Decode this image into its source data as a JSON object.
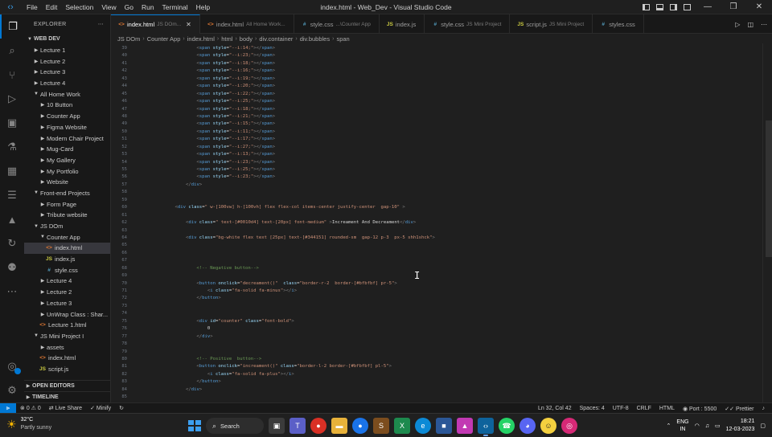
{
  "window": {
    "title": "index.html - Web_Dev - Visual Studio Code",
    "menu": [
      "File",
      "Edit",
      "Selection",
      "View",
      "Go",
      "Run",
      "Terminal",
      "Help"
    ]
  },
  "sidebar": {
    "header": "EXPLORER",
    "items": [
      {
        "label": "WEB DEV",
        "depth": 0,
        "type": "root",
        "open": true
      },
      {
        "label": "Lecture 1",
        "depth": 1,
        "type": "folder",
        "open": false
      },
      {
        "label": "Lecture 2",
        "depth": 1,
        "type": "folder",
        "open": false
      },
      {
        "label": "Lecture 3",
        "depth": 1,
        "type": "folder",
        "open": false
      },
      {
        "label": "Lecture 4",
        "depth": 1,
        "type": "folder",
        "open": false
      },
      {
        "label": "All Home Work",
        "depth": 1,
        "type": "folder",
        "open": true
      },
      {
        "label": "10 Button",
        "depth": 2,
        "type": "folder",
        "open": false
      },
      {
        "label": "Counter App",
        "depth": 2,
        "type": "folder",
        "open": false
      },
      {
        "label": "Figma Website",
        "depth": 2,
        "type": "folder",
        "open": false
      },
      {
        "label": "Modern Chair Project",
        "depth": 2,
        "type": "folder",
        "open": false
      },
      {
        "label": "Mug-Card",
        "depth": 2,
        "type": "folder",
        "open": false
      },
      {
        "label": "My Gallery",
        "depth": 2,
        "type": "folder",
        "open": false
      },
      {
        "label": "My Portfolio",
        "depth": 2,
        "type": "folder",
        "open": false
      },
      {
        "label": "Website",
        "depth": 2,
        "type": "folder",
        "open": false
      },
      {
        "label": "Front-end Projects",
        "depth": 1,
        "type": "folder",
        "open": true
      },
      {
        "label": "Form Page",
        "depth": 2,
        "type": "folder",
        "open": false
      },
      {
        "label": "Tribute website",
        "depth": 2,
        "type": "folder",
        "open": false
      },
      {
        "label": "JS DOm",
        "depth": 1,
        "type": "folder",
        "open": true
      },
      {
        "label": "Counter App",
        "depth": 2,
        "type": "folder",
        "open": true
      },
      {
        "label": "index.html",
        "depth": 3,
        "type": "html",
        "selected": true
      },
      {
        "label": "index.js",
        "depth": 3,
        "type": "js"
      },
      {
        "label": "style.css",
        "depth": 3,
        "type": "css"
      },
      {
        "label": "Lecture 4",
        "depth": 2,
        "type": "folder",
        "open": false
      },
      {
        "label": "Lecture 2",
        "depth": 2,
        "type": "folder",
        "open": false
      },
      {
        "label": "Lecture 3",
        "depth": 2,
        "type": "folder",
        "open": false
      },
      {
        "label": "UnWrap Class : Shar...",
        "depth": 2,
        "type": "folder",
        "open": false
      },
      {
        "label": "Lecture 1.html",
        "depth": 2,
        "type": "html"
      },
      {
        "label": "JS Mini Project I",
        "depth": 1,
        "type": "folder",
        "open": true
      },
      {
        "label": "assets",
        "depth": 2,
        "type": "folder",
        "open": false
      },
      {
        "label": "index.html",
        "depth": 2,
        "type": "html"
      },
      {
        "label": "script.js",
        "depth": 2,
        "type": "js"
      }
    ],
    "sections": [
      "OPEN EDITORS",
      "TIMELINE"
    ]
  },
  "tabs": [
    {
      "icon": "html",
      "label": "index.html",
      "desc": "JS DOm...",
      "active": true
    },
    {
      "icon": "html",
      "label": "index.html",
      "desc": "All Home Work...",
      "active": false
    },
    {
      "icon": "css",
      "label": "style.css",
      "desc": "...\\Counter App",
      "active": false
    },
    {
      "icon": "js",
      "label": "index.js",
      "desc": "",
      "active": false
    },
    {
      "icon": "css",
      "label": "style.css",
      "desc": "JS Mini Project",
      "active": false
    },
    {
      "icon": "js",
      "label": "script.js",
      "desc": "JS Mini Project",
      "active": false
    },
    {
      "icon": "css",
      "label": "styles.css",
      "desc": "",
      "active": false
    }
  ],
  "breadcrumb": [
    "JS DOm",
    "Counter App",
    "index.html",
    "html",
    "body",
    "div.container",
    "div.bubbles",
    "span"
  ],
  "editor": {
    "line_numbers": [
      "39",
      "40",
      "41",
      "42",
      "43",
      "44",
      "45",
      "46",
      "47",
      "48",
      "49",
      "50",
      "51",
      "52",
      "53",
      "54",
      "55",
      "56",
      "57",
      "58",
      "59",
      "60",
      "61",
      "62",
      "63",
      "64",
      "65",
      "66",
      "67",
      "68",
      "69",
      "70",
      "71",
      "72",
      "73",
      "74",
      "75",
      "76",
      "77",
      "78",
      "79",
      "80",
      "81",
      "82",
      "83",
      "84",
      "85"
    ],
    "lines": [
      "            <span style=\"--i:14;\"></span>",
      "            <span style=\"--i:23;\"></span>",
      "            <span style=\"--i:18;\"></span>",
      "            <span style=\"--i:16;\"></span>",
      "            <span style=\"--i:19;\"></span>",
      "            <span style=\"--i:20;\"></span>",
      "            <span style=\"--i:22;\"></span>",
      "            <span style=\"--i:25;\"></span>",
      "            <span style=\"--i:18;\"></span>",
      "            <span style=\"--i:21;\"></span>",
      "            <span style=\"--i:15;\"></span>",
      "            <span style=\"--i:11;\"></span>",
      "            <span style=\"--i:17;\"></span>",
      "            <span style=\"--i:27;\"></span>",
      "            <span style=\"--i:13;\"></span>",
      "            <span style=\"--i:23;\"></span>",
      "            <span style=\"--i:25;\"></span>",
      "            <span style=\"--i:23;\"></span>",
      "        </div>",
      "",
      "",
      "    <div class=\" w-[100vw] h-[100vh] flex flex-col items-center justify-center  gap-10\" >",
      "",
      "        <div class=\" text-[#0010d4] text-[20px] font-medium\" >Increament And Decreament</div>",
      "",
      "        <div class=\"bg-white flex text [25px] text-[#344151] rounded-sm  gap-12 p-3  px-5 shh1shck\">",
      "",
      "",
      "",
      "            <!-- Negative button-->",
      "",
      "            <button onclick=\"decreament()\"  class=\"border-r-2  border-[#bfbfbf] pr-5\">",
      "                <i class=\"fa-solid fa-minus\"></i>",
      "            </button>",
      "",
      "",
      "            <div id=\"counter\" class=\"font-bold\">",
      "                0",
      "            </div>",
      "",
      "",
      "            <!-- Positive  button-->",
      "            <button onclick=\"increament()\" class=\"border-l-2 border-[#bfbfbf] pl-5\">",
      "                <i class=\"fa-solid fa-plus\"></i>",
      "            </button>",
      "        </div>",
      ""
    ]
  },
  "statusbar": {
    "errors": "0",
    "warnings": "0",
    "live_share": "Live Share",
    "minify": "Minify",
    "position": "Ln 32, Col 42",
    "spaces": "Spaces: 4",
    "encoding": "UTF-8",
    "eol": "CRLF",
    "language": "HTML",
    "port": "Port : 5500",
    "prettier": "Prettier"
  },
  "taskbar": {
    "temperature": "32°C",
    "weather": "Partly sunny",
    "search": "Search",
    "lang_top": "ENG",
    "lang_bottom": "IN",
    "time": "18:21",
    "date": "12-03-2023"
  },
  "colors": {
    "accent": "#0078d4",
    "tag": "#569cd6",
    "attr": "#9cdcfe",
    "string": "#ce9178",
    "comment": "#6a9955",
    "text": "#d4d4d4"
  }
}
